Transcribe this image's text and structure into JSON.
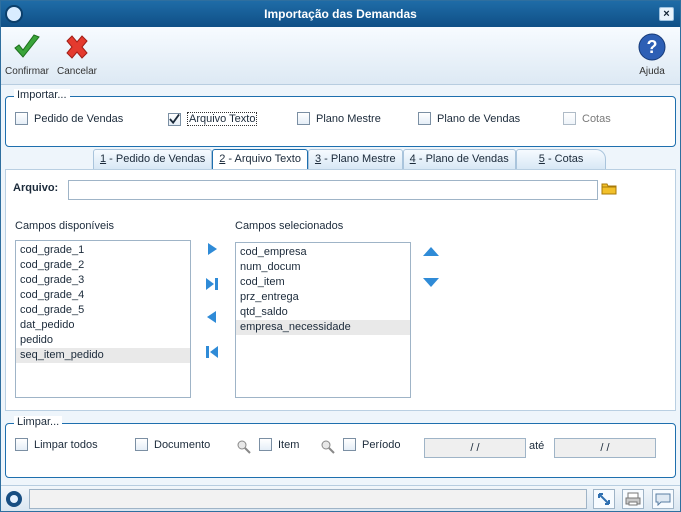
{
  "window": {
    "title": "Importação das Demandas",
    "close_label": "×"
  },
  "toolbar": {
    "confirm_label": "Confirmar",
    "cancel_label": "Cancelar",
    "help_label": "Ajuda"
  },
  "importar": {
    "title": "Importar...",
    "options": [
      {
        "label": "Pedido de Vendas",
        "checked": false
      },
      {
        "label": "Arquivo Texto",
        "checked": true
      },
      {
        "label": "Plano Mestre",
        "checked": false
      },
      {
        "label": "Plano de Vendas",
        "checked": false
      },
      {
        "label": "Cotas",
        "checked": false,
        "disabled": true
      }
    ]
  },
  "tabs": [
    {
      "num": "1",
      "text": " - Pedido de Vendas"
    },
    {
      "num": "2",
      "text": " - Arquivo Texto",
      "active": true
    },
    {
      "num": "3",
      "text": " - Plano Mestre"
    },
    {
      "num": "4",
      "text": " - Plano de Vendas"
    },
    {
      "num": "5",
      "text": " - Cotas"
    }
  ],
  "arquivo": {
    "label": "Arquivo:",
    "value": ""
  },
  "campos_disponiveis": {
    "label": "Campos disponíveis",
    "items": [
      "cod_grade_1",
      "cod_grade_2",
      "cod_grade_3",
      "cod_grade_4",
      "cod_grade_5",
      "dat_pedido",
      "pedido",
      "seq_item_pedido"
    ]
  },
  "campos_selecionados": {
    "label": "Campos selecionados",
    "items": [
      "cod_empresa",
      "num_docum",
      "cod_item",
      "prz_entrega",
      "qtd_saldo",
      "empresa_necessidade"
    ]
  },
  "limpar": {
    "title": "Limpar...",
    "todos_label": "Limpar todos",
    "documento_label": "Documento",
    "item_label": "Item",
    "periodo_label": "Período",
    "date_from": "/ /",
    "ate_label": "até",
    "date_to": "/ /"
  },
  "colors": {
    "accent": "#1e6fae",
    "titlebar": "#175f98"
  }
}
